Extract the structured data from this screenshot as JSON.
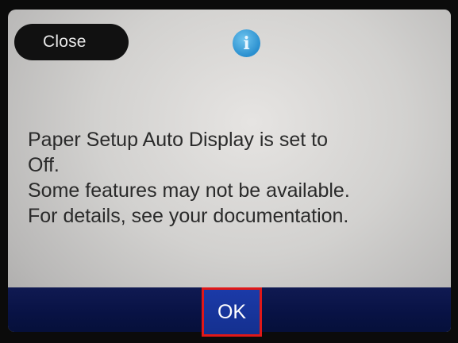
{
  "header": {
    "close_label": "Close",
    "info_icon": "info-icon"
  },
  "message": {
    "lines": [
      "Paper Setup Auto Display is set to",
      "Off.",
      "Some features may not be available.",
      "For details, see your documentation."
    ]
  },
  "footer": {
    "ok_label": "OK"
  },
  "colors": {
    "screen_bg": "#d2d1cf",
    "bottom_bar": "#081244",
    "ok_button": "#1b3aa8",
    "highlight_border": "#e01818",
    "info_icon": "#2a8fcf"
  }
}
